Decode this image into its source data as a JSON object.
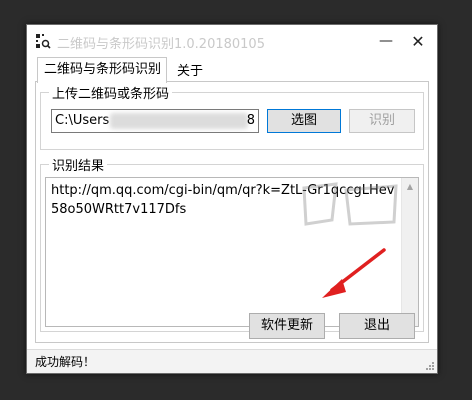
{
  "window": {
    "title": "二维码与条形码识别1.0.20180105",
    "minimize_glyph": "—",
    "close_glyph": "✕"
  },
  "tabs": [
    {
      "label": "二维码与条形码识别",
      "active": true
    },
    {
      "label": "关于",
      "active": false
    }
  ],
  "upload": {
    "legend": "上传二维码或条形码",
    "path_prefix": "C:\\Users",
    "path_suffix": "8",
    "select_label": "选图",
    "recognize_label": "识别"
  },
  "result": {
    "legend": "识别结果",
    "text": "http://qm.qq.com/cgi-bin/qm/qr?k=ZtL-Gr1qccgLHev58o50WRtt7v117Dfs"
  },
  "buttons": {
    "update_label": "软件更新",
    "exit_label": "退出"
  },
  "status": {
    "text": "成功解码！"
  },
  "colors": {
    "arrow": "#e02020",
    "accent_border": "#0078d7"
  }
}
